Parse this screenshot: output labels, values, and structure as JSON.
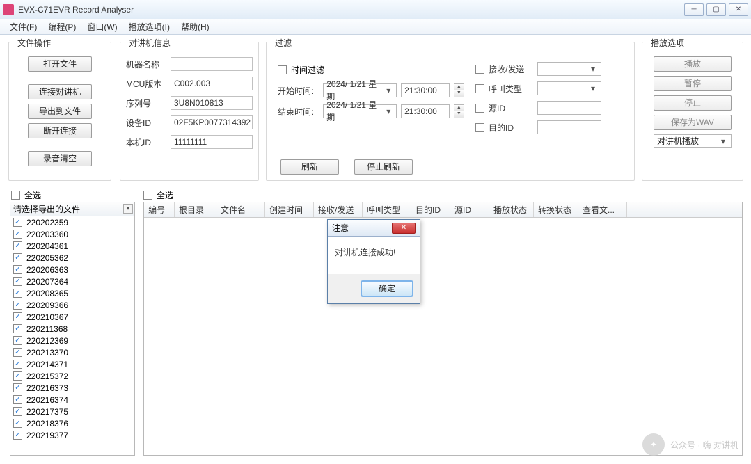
{
  "window": {
    "title": "EVX-C71EVR Record Analyser"
  },
  "menu": {
    "file": "文件(F)",
    "program": "编程(P)",
    "window": "窗口(W)",
    "playopts": "播放选项(I)",
    "help": "帮助(H)"
  },
  "fileops": {
    "legend": "文件操作",
    "open": "打开文件",
    "connect": "连接对讲机",
    "export": "导出到文件",
    "disconnect": "断开连接",
    "clear": "录音清空"
  },
  "radioinfo": {
    "legend": "对讲机信息",
    "name_lbl": "机器名称",
    "name_val": "",
    "mcu_lbl": "MCU版本",
    "mcu_val": "C002.003",
    "sn_lbl": "序列号",
    "sn_val": "3U8N010813",
    "dev_lbl": "设备ID",
    "dev_val": "02F5KP0077314392",
    "local_lbl": "本机ID",
    "local_val": "11111111"
  },
  "filter": {
    "legend": "过滤",
    "timefilter": "时间过滤",
    "start_lbl": "开始时间:",
    "end_lbl": "结束时间:",
    "date": "2024/ 1/21 星期",
    "time": "21:30:00",
    "rxtx": "接收/发送",
    "calltype": "呼叫类型",
    "srcid": "源ID",
    "dstid": "目的ID",
    "refresh": "刷新",
    "stoprefresh": "停止刷新"
  },
  "playback": {
    "legend": "播放选项",
    "play": "播放",
    "pause": "暂停",
    "stop": "停止",
    "savewav": "保存为WAV",
    "device": "对讲机播放"
  },
  "selectall": "全选",
  "filelist": {
    "header": "请选择导出的文件",
    "items": [
      "220202359",
      "220203360",
      "220204361",
      "220205362",
      "220206363",
      "220207364",
      "220208365",
      "220209366",
      "220210367",
      "220211368",
      "220212369",
      "220213370",
      "220214371",
      "220215372",
      "220216373",
      "220216374",
      "220217375",
      "220218376",
      "220219377"
    ]
  },
  "grid": {
    "cols": [
      "编号",
      "根目录",
      "文件名",
      "创建时间",
      "接收/发送",
      "呼叫类型",
      "目的ID",
      "源ID",
      "播放状态",
      "转换状态",
      "查看文..."
    ]
  },
  "dialog": {
    "title": "注意",
    "msg": "对讲机连接成功!",
    "ok": "确定"
  },
  "watermark": {
    "text": "公众号 · 嗨 对讲机"
  }
}
